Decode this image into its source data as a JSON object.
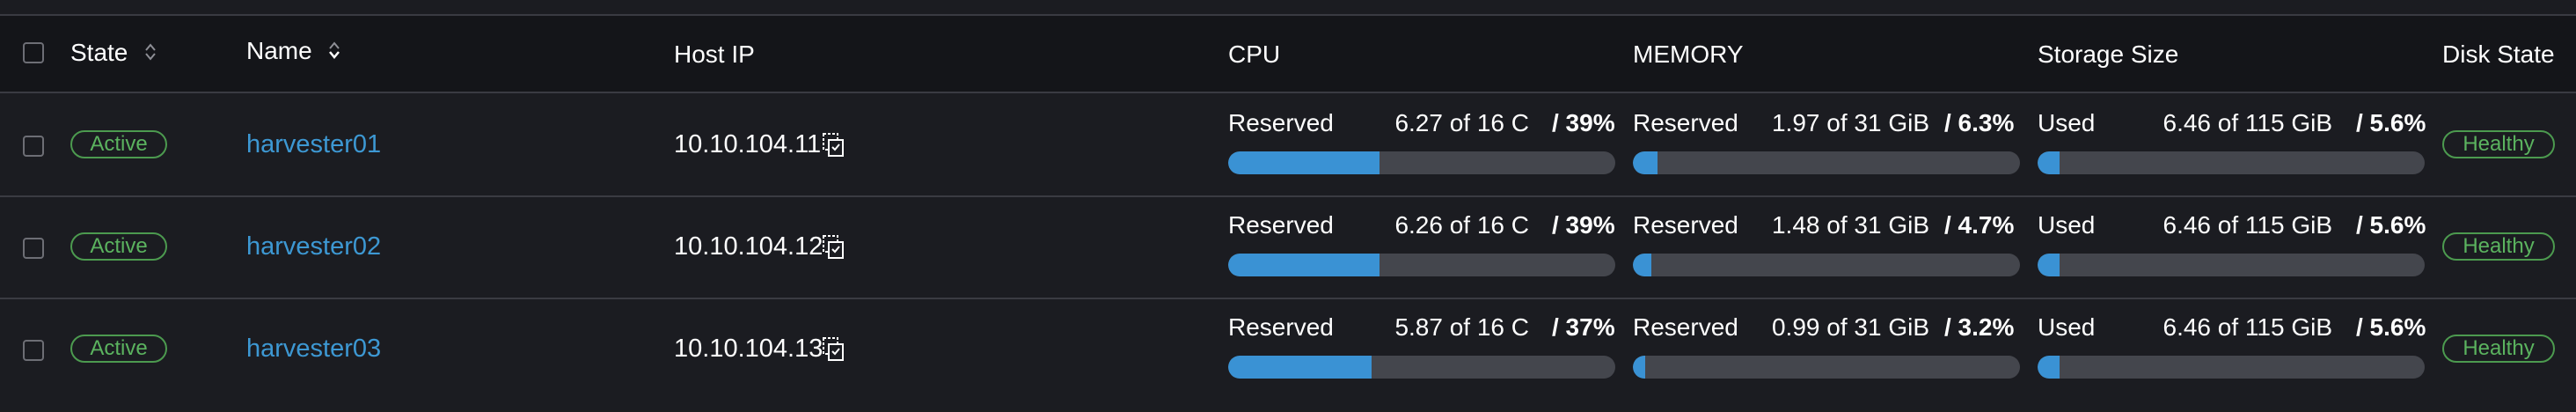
{
  "header": {
    "state": "State",
    "name": "Name",
    "host_ip": "Host IP",
    "cpu": "CPU",
    "memory": "MEMORY",
    "storage": "Storage Size",
    "disk_state": "Disk State"
  },
  "rows": [
    {
      "state": "Active",
      "name": "harvester01",
      "ip": "10.10.104.11",
      "cpu": {
        "label": "Reserved",
        "value": "6.27 of 16 C",
        "pct": "/ 39%",
        "fraction": 0.39
      },
      "memory": {
        "label": "Reserved",
        "value": "1.97 of 31 GiB",
        "pct": "/ 6.3%",
        "fraction": 0.063
      },
      "storage": {
        "label": "Used",
        "value": "6.46 of 115 GiB",
        "pct": "/ 5.6%",
        "fraction": 0.056
      },
      "disk": "Healthy"
    },
    {
      "state": "Active",
      "name": "harvester02",
      "ip": "10.10.104.12",
      "cpu": {
        "label": "Reserved",
        "value": "6.26 of 16 C",
        "pct": "/ 39%",
        "fraction": 0.39
      },
      "memory": {
        "label": "Reserved",
        "value": "1.48 of 31 GiB",
        "pct": "/ 4.7%",
        "fraction": 0.047
      },
      "storage": {
        "label": "Used",
        "value": "6.46 of 115 GiB",
        "pct": "/ 5.6%",
        "fraction": 0.056
      },
      "disk": "Healthy"
    },
    {
      "state": "Active",
      "name": "harvester03",
      "ip": "10.10.104.13",
      "cpu": {
        "label": "Reserved",
        "value": "5.87 of 16 C",
        "pct": "/ 37%",
        "fraction": 0.37
      },
      "memory": {
        "label": "Reserved",
        "value": "0.99 of 31 GiB",
        "pct": "/ 3.2%",
        "fraction": 0.032
      },
      "storage": {
        "label": "Used",
        "value": "6.46 of 115 GiB",
        "pct": "/ 5.6%",
        "fraction": 0.056
      },
      "disk": "Healthy"
    }
  ],
  "colors": {
    "accent": "#3a92d4",
    "link": "#3d98d3",
    "active_green": "#5bb35f",
    "bar_track": "#44464d"
  },
  "icons": {
    "sort": "sort-icon",
    "copy": "copy-icon",
    "checkbox": "checkbox"
  }
}
